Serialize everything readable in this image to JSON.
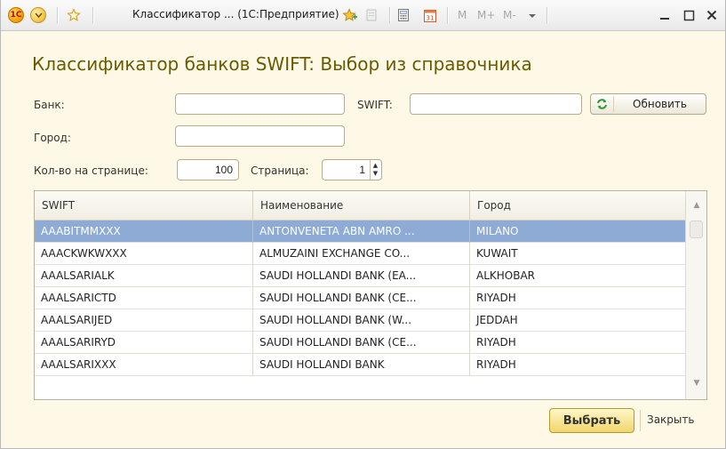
{
  "window": {
    "title": "Классификатор ... (1С:Предприятие)",
    "logo_text": "1С",
    "m_buttons": [
      "M",
      "M+",
      "M-"
    ]
  },
  "form": {
    "title": "Классификатор банков SWIFT: Выбор из справочника",
    "bank_label": "Банк:",
    "bank_value": "",
    "swift_label": "SWIFT:",
    "swift_value": "",
    "refresh_label": "Обновить",
    "city_label": "Город:",
    "city_value": "",
    "per_page_label": "Кол-во на странице:",
    "per_page_value": "100",
    "page_label": "Страница:",
    "page_value": "1"
  },
  "table": {
    "columns": [
      "SWIFT",
      "Наименование",
      "Город"
    ],
    "rows": [
      {
        "swift": "AAABITMMXXX",
        "name": "ANTONVENETA ABN AMRO ...",
        "city": "MILANO"
      },
      {
        "swift": "AAACKWKWXXX",
        "name": "ALMUZAINI EXCHANGE CO...",
        "city": "KUWAIT"
      },
      {
        "swift": "AAALSARIALK",
        "name": "SAUDI HOLLANDI BANK (EA...",
        "city": "ALKHOBAR"
      },
      {
        "swift": "AAALSARICTD",
        "name": "SAUDI HOLLANDI BANK (CE...",
        "city": "RIYADH"
      },
      {
        "swift": "AAALSARIJED",
        "name": "SAUDI HOLLANDI BANK (W...",
        "city": "JEDDAH"
      },
      {
        "swift": "AAALSARIRYD",
        "name": "SAUDI HOLLANDI BANK (CE...",
        "city": "RIYADH"
      },
      {
        "swift": "AAALSARIXXX",
        "name": "SAUDI HOLLANDI BANK",
        "city": "RIYADH"
      }
    ]
  },
  "footer": {
    "select_label": "Выбрать",
    "close_label": "Закрыть"
  },
  "colors": {
    "background": "#fdf9e6",
    "title_color": "#6a5a00",
    "selected_row": "#8eabd6",
    "select_button": "#f1d66b"
  }
}
